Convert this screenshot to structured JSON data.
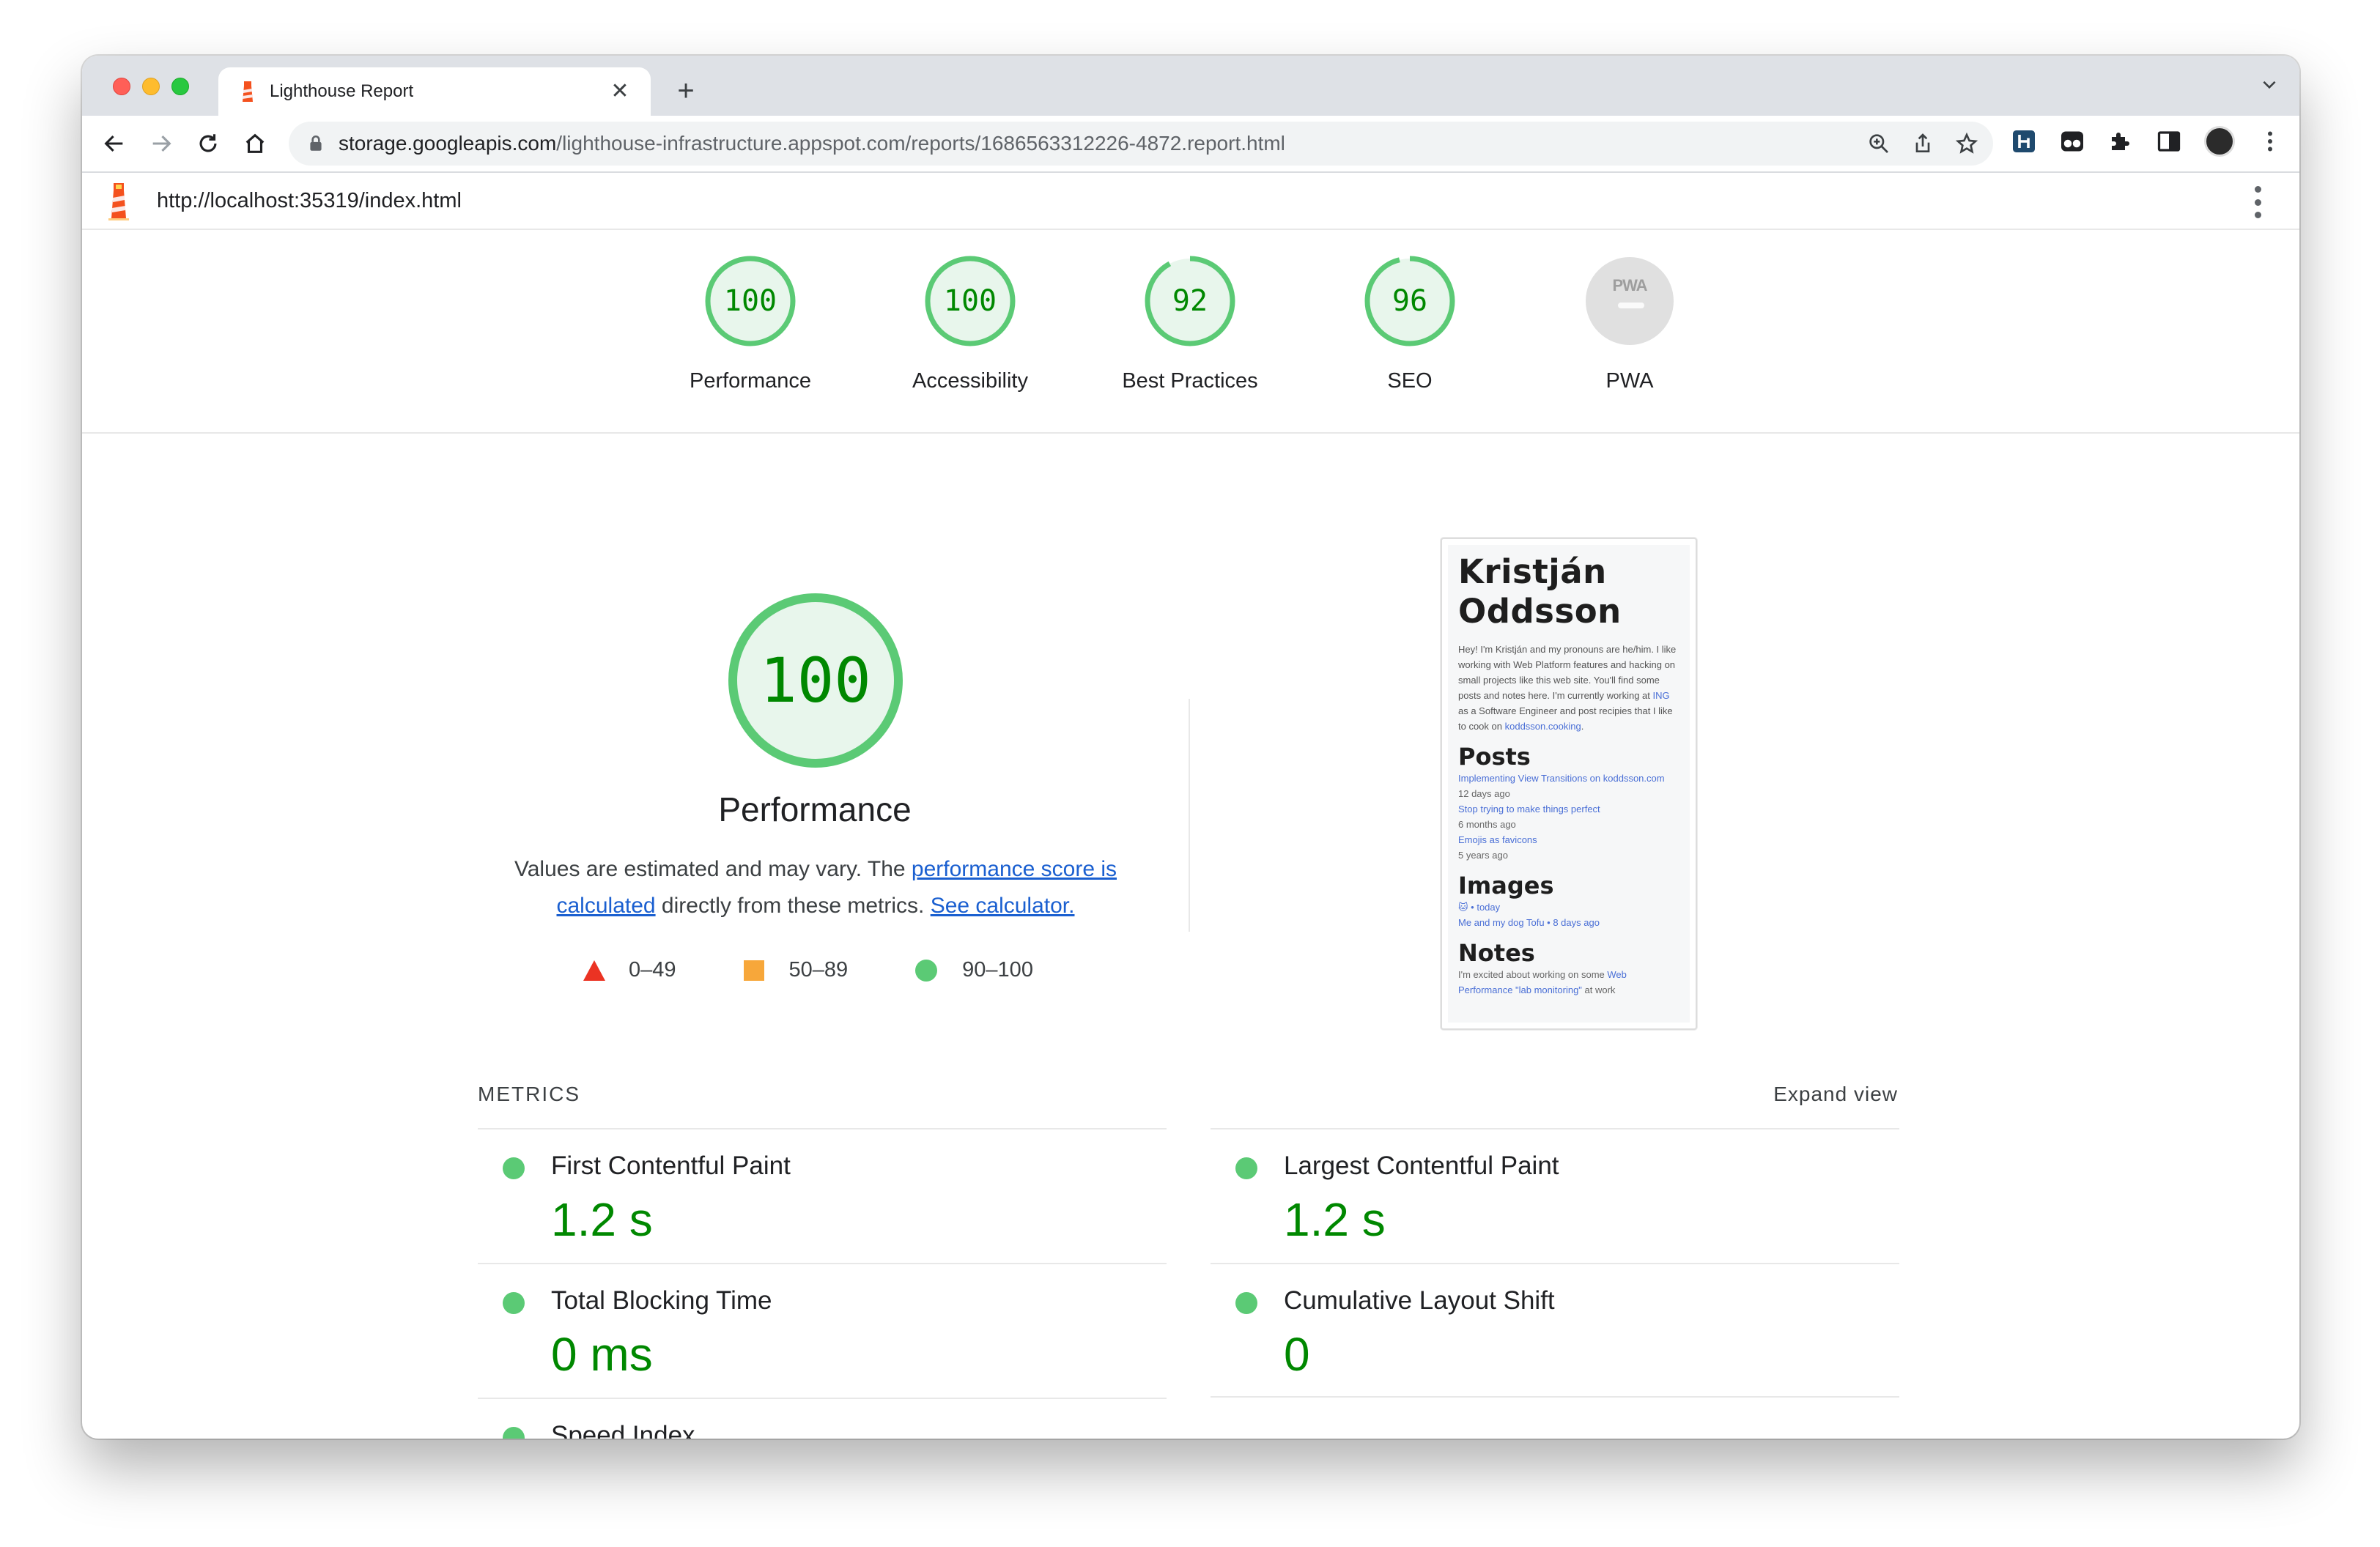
{
  "browser": {
    "tab_title": "Lighthouse Report",
    "tab_close": "✕",
    "new_tab": "+",
    "url_host": "storage.googleapis.com",
    "url_path": "/lighthouse-infrastructure.appspot.com/reports/1686563312226-4872.report.html"
  },
  "lighthouse": {
    "page_url": "http://localhost:35319/index.html",
    "gauges": [
      {
        "label": "Performance",
        "score": "100",
        "value": 100
      },
      {
        "label": "Accessibility",
        "score": "100",
        "value": 100
      },
      {
        "label": "Best Practices",
        "score": "92",
        "value": 92
      },
      {
        "label": "SEO",
        "score": "96",
        "value": 96
      },
      {
        "label": "PWA",
        "score": "PWA",
        "value": null
      }
    ],
    "performance": {
      "score": "100",
      "value": 100,
      "title": "Performance",
      "desc_prefix": "Values are estimated and may vary. The ",
      "desc_link1": "performance score is calculated",
      "desc_middle": " directly from these metrics. ",
      "desc_link2": "See calculator."
    },
    "legend": [
      {
        "range": "0–49"
      },
      {
        "range": "50–89"
      },
      {
        "range": "90–100"
      }
    ],
    "metrics_title": "METRICS",
    "expand_view": "Expand view",
    "metrics": [
      {
        "name": "First Contentful Paint",
        "value": "1.2 s"
      },
      {
        "name": "Largest Contentful Paint",
        "value": "1.2 s"
      },
      {
        "name": "Total Blocking Time",
        "value": "0 ms"
      },
      {
        "name": "Cumulative Layout Shift",
        "value": "0"
      },
      {
        "name": "Speed Index",
        "value": ""
      }
    ],
    "screenshot": {
      "name_line1": "Kristján",
      "name_line2": "Oddsson",
      "bio_1": "Hey! I'm Kristján and my pronouns are he/him. I like working with Web Platform features and hacking on small projects like this web site. You'll find some posts and notes here. I'm currently working at ",
      "bio_ing": "ING",
      "bio_2": " as a Software Engineer and post recipies that I like to cook on ",
      "bio_cook": "koddsson.cooking",
      "bio_3": ".",
      "posts_heading": "Posts",
      "posts": [
        {
          "title": "Implementing View Transitions on koddsson.com",
          "meta": "12 days ago"
        },
        {
          "title": "Stop trying to make things perfect",
          "meta": "6 months ago"
        },
        {
          "title": "Emojis as favicons",
          "meta": "5 years ago"
        }
      ],
      "images_heading": "Images",
      "images": [
        {
          "title": "🐱 • today"
        },
        {
          "title": "Me and my dog Tofu • 8 days ago"
        }
      ],
      "notes_heading": "Notes",
      "note_1": "I'm excited about working on some ",
      "note_link": "Web Performance \"lab monitoring\"",
      "note_2": " at work"
    }
  },
  "colors": {
    "pass": "#0cce6b",
    "pass_text": "#008800",
    "average": "#ffa400",
    "fail": "#ff4e42",
    "link": "#1a5fd0"
  }
}
